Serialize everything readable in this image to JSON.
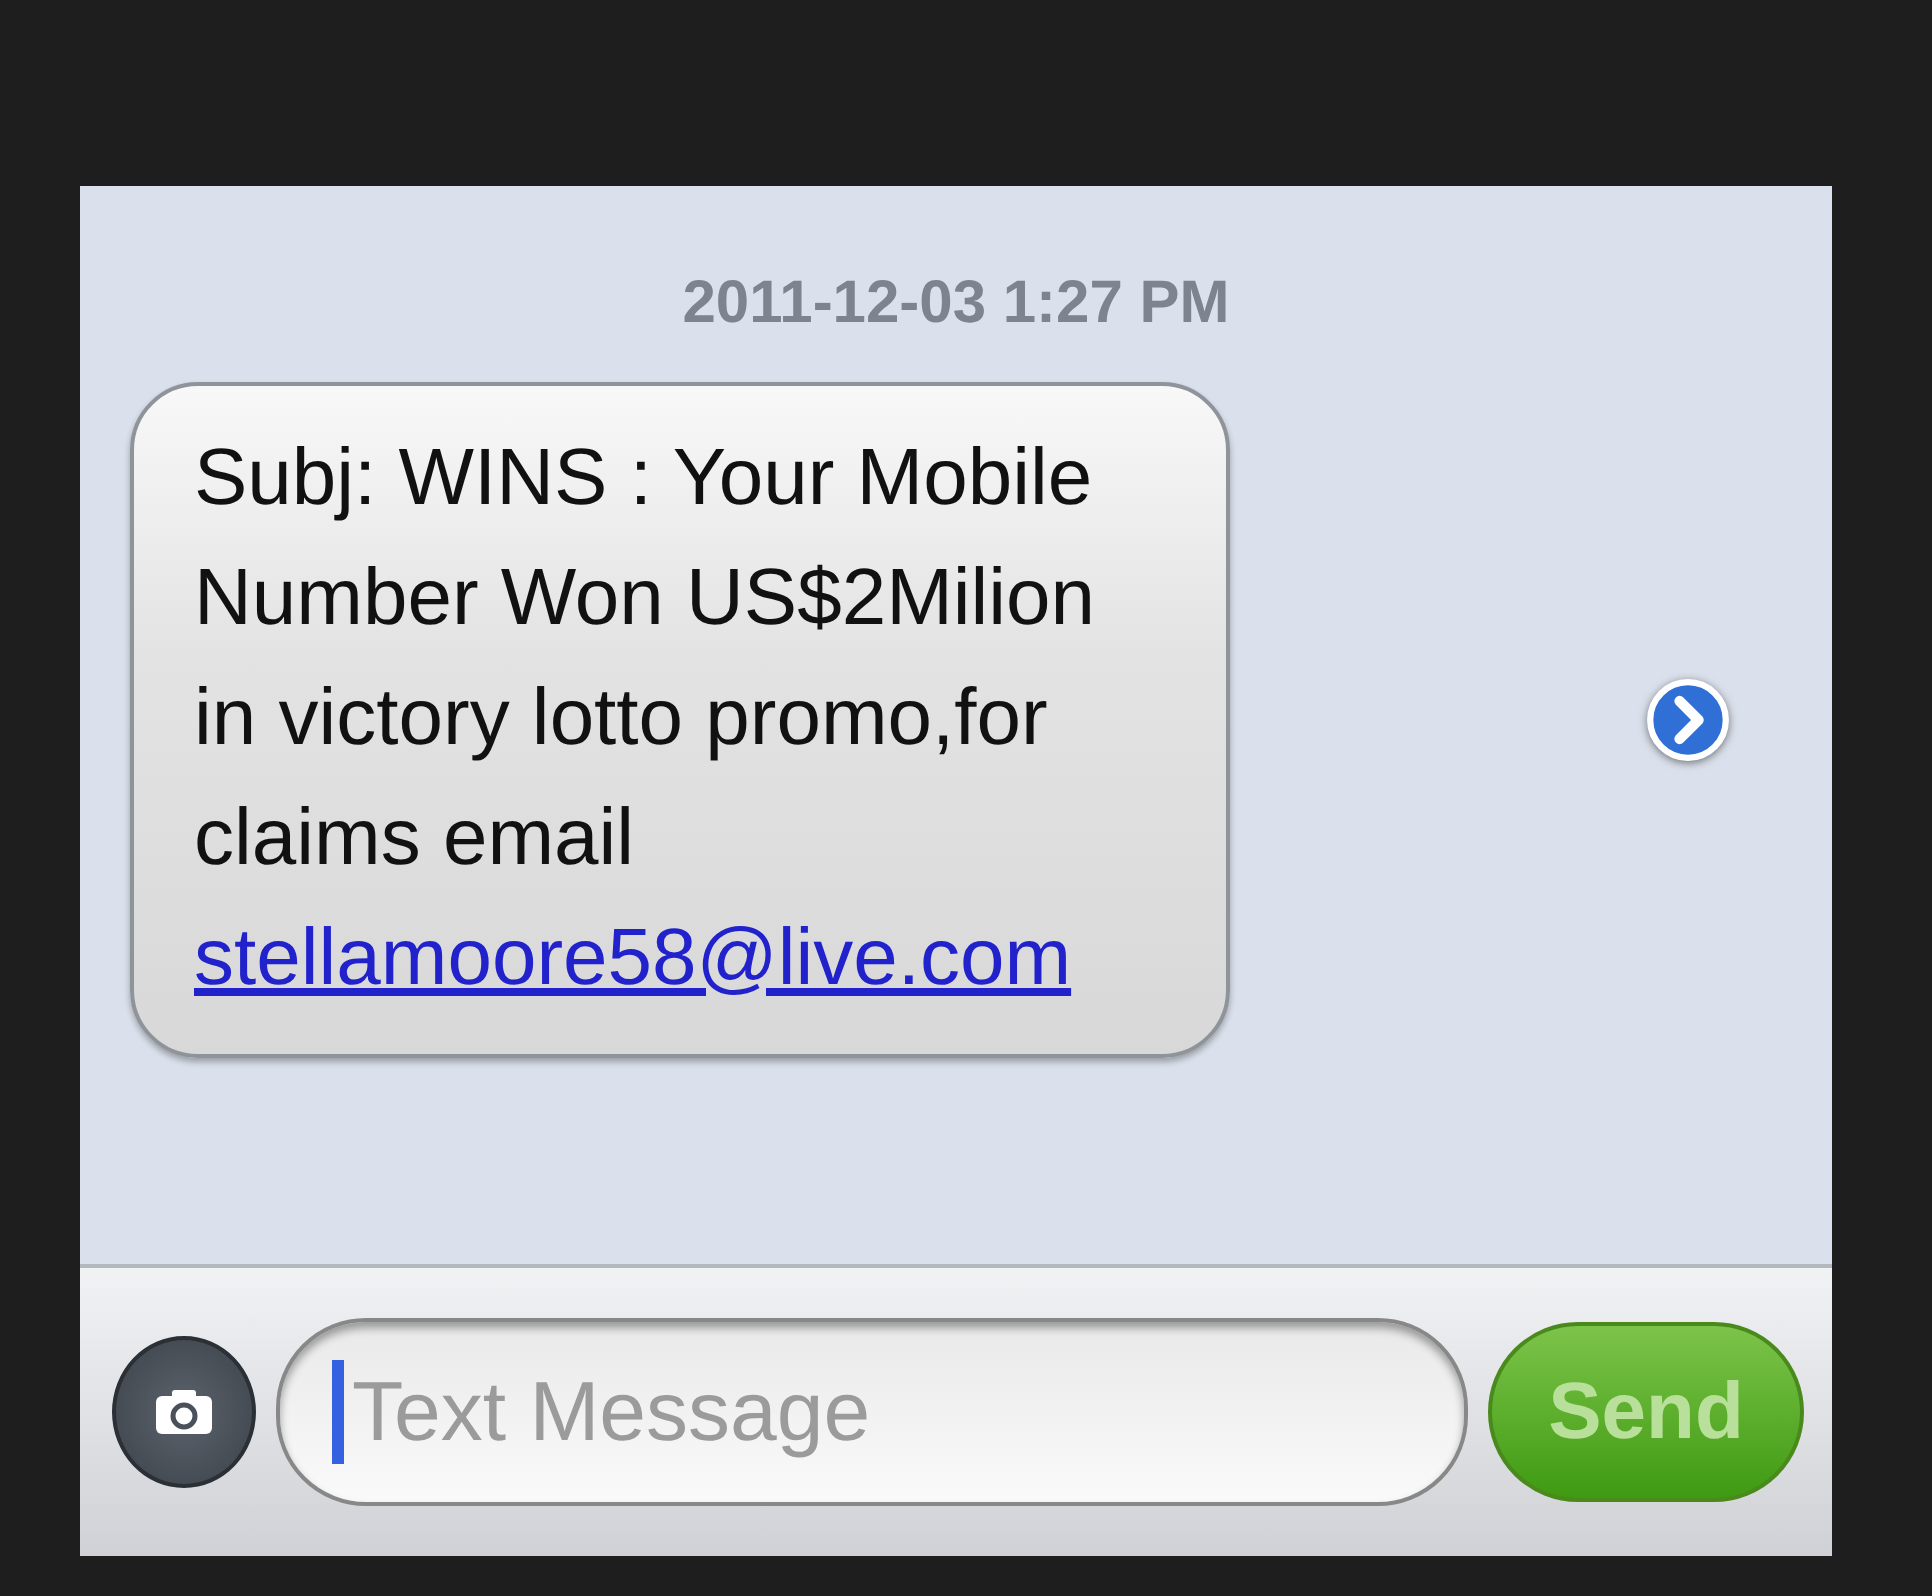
{
  "conversation": {
    "timestamp": "2011-12-03 1:27 PM",
    "messages": [
      {
        "text": "Subj: WINS : Your Mobile Number Won US$2Milion in victory lotto promo,for claims email",
        "link": "stellamoore58@live.com"
      }
    ]
  },
  "composer": {
    "placeholder": "Text Message",
    "send": {
      "label": "Send",
      "disabled": true
    }
  }
}
